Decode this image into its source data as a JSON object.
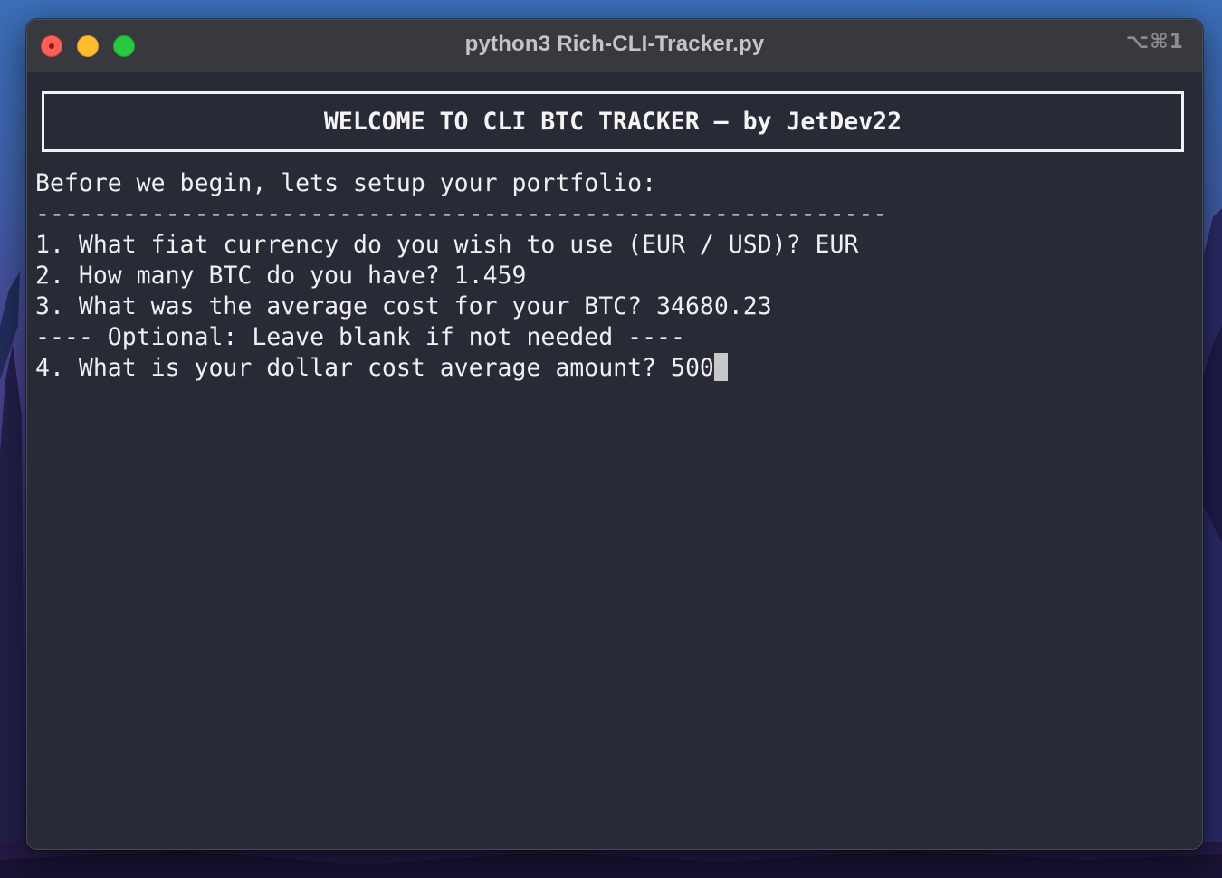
{
  "window": {
    "title": "python3 Rich-CLI-Tracker.py",
    "shortcut": "⌥⌘1"
  },
  "terminal": {
    "banner": "WELCOME TO CLI BTC TRACKER – by JetDev22",
    "intro": "Before we begin, lets setup your portfolio:",
    "divider": "-----------------------------------------------------------",
    "questions": [
      "1. What fiat currency do you wish to use (EUR / USD)? EUR",
      "2. How many BTC do you have? 1.459",
      "3. What was the average cost for your BTC? 34680.23"
    ],
    "optional_note": "---- Optional: Leave blank if not needed ----",
    "current_prompt": "4. What is your dollar cost average amount? ",
    "current_input": "500"
  },
  "colors": {
    "terminal_bg": "#282a36",
    "titlebar_bg": "#38393f",
    "close": "#ff5f57",
    "minimize": "#febc2e",
    "zoom": "#28c840"
  }
}
